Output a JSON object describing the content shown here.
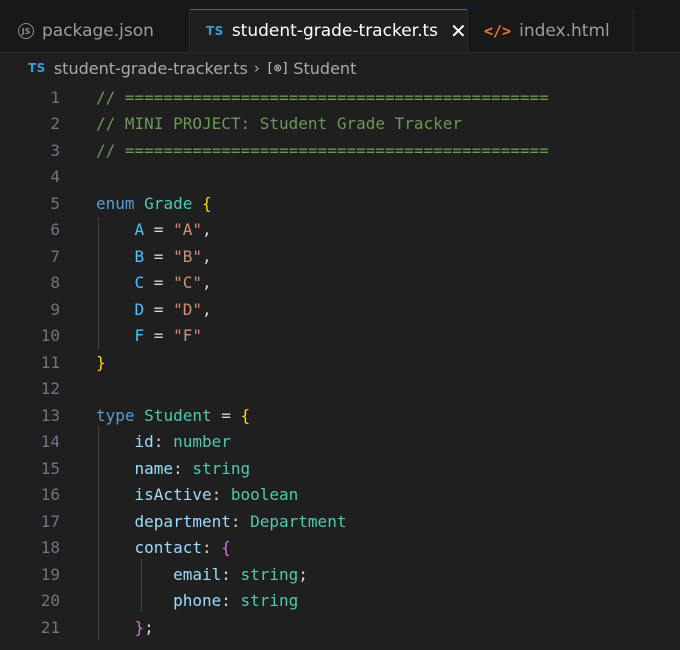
{
  "tabs": [
    {
      "label": "package.json",
      "icon": "js-icon",
      "active": false
    },
    {
      "label": "student-grade-tracker.ts",
      "icon": "ts-icon",
      "active": true
    },
    {
      "label": "index.html",
      "icon": "html-icon",
      "active": false
    }
  ],
  "icons": {
    "ts": "TS",
    "js": "JS",
    "html": "</>",
    "close": "✕",
    "chevron": "›",
    "symbol": "[⊗]"
  },
  "breadcrumb": {
    "file": "student-grade-tracker.ts",
    "symbol": "Student"
  },
  "line_numbers": [
    "1",
    "2",
    "3",
    "4",
    "5",
    "6",
    "7",
    "8",
    "9",
    "10",
    "11",
    "12",
    "13",
    "14",
    "15",
    "16",
    "17",
    "18",
    "19",
    "20",
    "21"
  ],
  "code": {
    "l1": {
      "comment": "// ============================================"
    },
    "l2": {
      "comment": "// MINI PROJECT: Student Grade Tracker"
    },
    "l3": {
      "comment": "// ============================================"
    },
    "l5": {
      "kw": "enum",
      "name": "Grade",
      "brace": "{"
    },
    "l6": {
      "member": "A",
      "eq": " = ",
      "value": "\"A\"",
      "punct": ","
    },
    "l7": {
      "member": "B",
      "eq": " = ",
      "value": "\"B\"",
      "punct": ","
    },
    "l8": {
      "member": "C",
      "eq": " = ",
      "value": "\"C\"",
      "punct": ","
    },
    "l9": {
      "member": "D",
      "eq": " = ",
      "value": "\"D\"",
      "punct": ","
    },
    "l10": {
      "member": "F",
      "eq": " = ",
      "value": "\"F\""
    },
    "l11": {
      "brace": "}"
    },
    "l13": {
      "kw": "type",
      "name": "Student",
      "eq": " = ",
      "brace": "{"
    },
    "l14": {
      "prop": "id",
      "colon": ": ",
      "type": "number"
    },
    "l15": {
      "prop": "name",
      "colon": ": ",
      "type": "string"
    },
    "l16": {
      "prop": "isActive",
      "colon": ": ",
      "type": "boolean"
    },
    "l17": {
      "prop": "department",
      "colon": ": ",
      "type": "Department"
    },
    "l18": {
      "prop": "contact",
      "colon": ": ",
      "brace": "{"
    },
    "l19": {
      "prop": "email",
      "colon": ": ",
      "type": "string",
      "punct": ";"
    },
    "l20": {
      "prop": "phone",
      "colon": ": ",
      "type": "string"
    },
    "l21": {
      "brace": "}",
      "punct": ";"
    }
  },
  "colors": {
    "comment": "#6a9955",
    "keyword": "#569cd6",
    "type": "#4ec9b0",
    "enum_member": "#4fc1ff",
    "property": "#9cdcfe",
    "string": "#ce9178",
    "bracket_level1": "#ffd700",
    "bracket_level2": "#da70d6",
    "accent": "#0078d4"
  }
}
